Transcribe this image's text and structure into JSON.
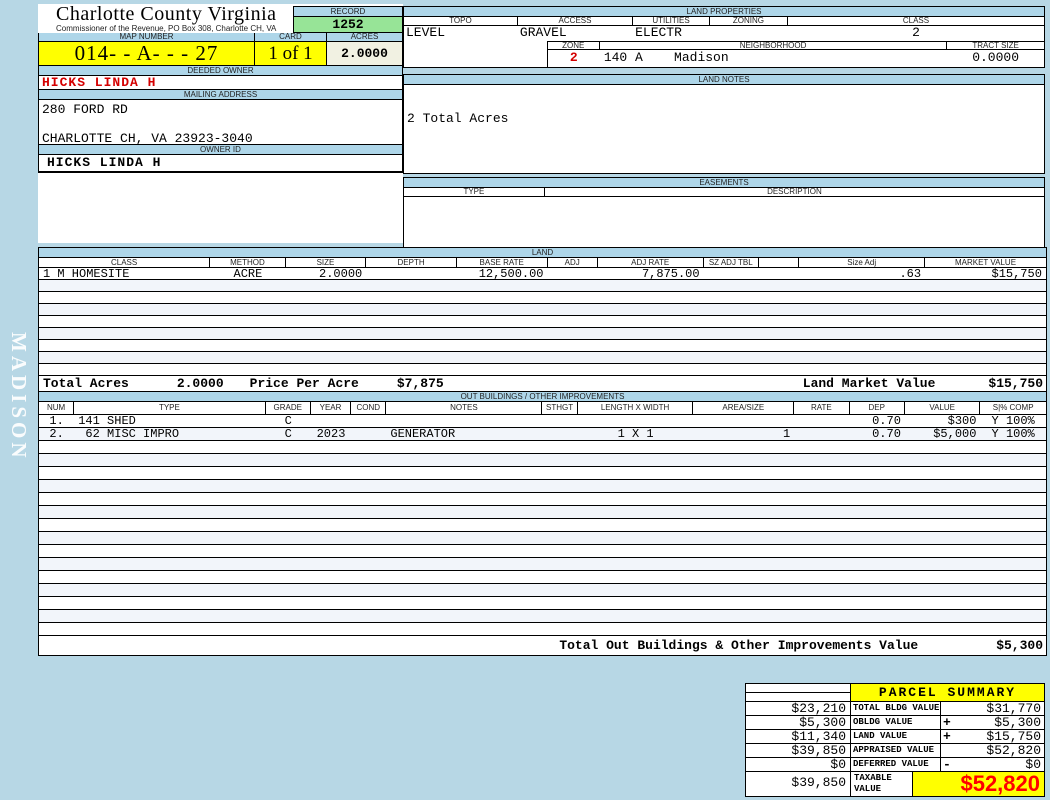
{
  "sidebar": {
    "label": "MADISON"
  },
  "header": {
    "title": "Charlotte County Virginia",
    "subtitle": "Commissioner of the Revenue, PO Box 308, Charlotte CH, VA",
    "record_label": "RECORD",
    "record_value": "1252",
    "map_label": "MAP NUMBER",
    "map_value": "014- - A-  -  - 27",
    "card_label": "CARD",
    "card_value": "1 of 1",
    "acres_label": "ACRES",
    "acres_value": "2.0000"
  },
  "owner": {
    "deeded_label": "DEEDED OWNER",
    "deeded_value": "HICKS LINDA H",
    "mailing_label": "MAILING ADDRESS",
    "address_line1": "280 FORD RD",
    "address_line2": "CHARLOTTE CH, VA 23923-3040",
    "owner_id_label": "OWNER ID",
    "owner_id_value": "HICKS LINDA H"
  },
  "land_properties": {
    "title": "LAND PROPERTIES",
    "topo_label": "TOPO",
    "topo": "LEVEL",
    "access_label": "ACCESS",
    "access": "GRAVEL",
    "utilities_label": "UTILITIES",
    "utilities": "ELECTR",
    "zoning_label": "ZONING",
    "zoning": "",
    "class_label": "CLASS",
    "class": "2",
    "zone_label": "ZONE",
    "zone": "2",
    "neighborhood_label": "NEIGHBORHOOD",
    "neighborhood_value": "140 A    Madison",
    "tract_label": "TRACT SIZE",
    "tract": "0.0000"
  },
  "land_notes": {
    "title": "LAND NOTES",
    "note": "2 Total Acres"
  },
  "easements": {
    "title": "EASEMENTS",
    "type_label": "TYPE",
    "description_label": "DESCRIPTION"
  },
  "land_table": {
    "title": "LAND",
    "columns": [
      {
        "label": "CLASS",
        "w": 17,
        "align": "left"
      },
      {
        "label": "METHOD",
        "w": 7.5,
        "align": "center"
      },
      {
        "label": "SIZE",
        "w": 8,
        "align": "right"
      },
      {
        "label": "DEPTH",
        "w": 9,
        "align": "right"
      },
      {
        "label": "BASE RATE",
        "w": 9,
        "align": "right"
      },
      {
        "label": "ADJ",
        "w": 5,
        "align": "right"
      },
      {
        "label": "ADJ RATE",
        "w": 10.5,
        "align": "right"
      },
      {
        "label": "SZ ADJ TBL",
        "w": 5.5,
        "align": "center"
      },
      {
        "label": "",
        "w": 4,
        "align": "center"
      },
      {
        "label": "Size Adj",
        "w": 12.5,
        "align": "right"
      },
      {
        "label": "MARKET VALUE",
        "w": 12,
        "align": "right"
      }
    ],
    "rows": [
      [
        "1 M HOMESITE",
        "ACRE",
        "2.0000",
        "",
        "12,500.00",
        "",
        "7,875.00",
        "",
        "",
        ".63",
        "$15,750"
      ]
    ],
    "empty_rows": 8,
    "totals": {
      "acres_label": "Total Acres",
      "acres": "2.0000",
      "ppa_label": "Price Per Acre",
      "ppa": "$7,875",
      "market_label": "Land Market Value",
      "market": "$15,750"
    }
  },
  "out_buildings": {
    "title": "OUT BUILDINGS / OTHER IMPROVEMENTS",
    "columns": [
      {
        "label": "NUM",
        "w": 3.5,
        "align": "center"
      },
      {
        "label": "TYPE",
        "w": 19,
        "align": "left"
      },
      {
        "label": "GRADE",
        "w": 4.5,
        "align": "center"
      },
      {
        "label": "YEAR",
        "w": 4,
        "align": "center"
      },
      {
        "label": "COND",
        "w": 3.5,
        "align": "center"
      },
      {
        "label": "NOTES",
        "w": 15.5,
        "align": "left"
      },
      {
        "label": "STHGT",
        "w": 3.5,
        "align": "center"
      },
      {
        "label": "LENGTH X WIDTH",
        "w": 11.5,
        "align": "center"
      },
      {
        "label": "AREA/SIZE",
        "w": 10,
        "align": "right"
      },
      {
        "label": "RATE",
        "w": 5.5,
        "align": "right"
      },
      {
        "label": "DEP",
        "w": 5.5,
        "align": "right"
      },
      {
        "label": "VALUE",
        "w": 7.5,
        "align": "right"
      },
      {
        "label": "S|% COMP",
        "w": 6.5,
        "align": "center"
      }
    ],
    "rows": [
      [
        "1.",
        "141 SHED",
        "C",
        "",
        "",
        "",
        "",
        "",
        "",
        "",
        "0.70",
        "$300",
        "Y 100%"
      ],
      [
        "2.",
        " 62 MISC IMPRO",
        "C",
        "2023",
        "",
        "GENERATOR",
        "",
        "1 X 1",
        "1",
        "",
        "0.70",
        "$5,000",
        "Y 100%"
      ]
    ],
    "empty_rows": 15,
    "total_label": "Total Out Buildings & Other Improvements Value",
    "total_value": "$5,300"
  },
  "parcel_summary": {
    "title": "PARCEL SUMMARY",
    "rows": [
      {
        "prior": "$23,210",
        "label": "TOTAL BLDG VALUE",
        "op": "",
        "value": "$31,770"
      },
      {
        "prior": "$5,300",
        "label": "OBLDG VALUE",
        "op": "+",
        "value": "$5,300"
      },
      {
        "prior": "$11,340",
        "label": "LAND VALUE",
        "op": "+",
        "value": "$15,750"
      },
      {
        "prior": "$39,850",
        "label": "APPRAISED VALUE",
        "op": "",
        "value": "$52,820"
      },
      {
        "prior": "$0",
        "label": "DEFERRED VALUE",
        "op": "-",
        "value": "$0"
      }
    ],
    "taxable": {
      "prior": "$39,850",
      "label": "TAXABLE VALUE",
      "value": "$52,820"
    }
  },
  "colors": {
    "page_bg": "#b7d7e5",
    "header_bar": "#aed6e9",
    "highlight_yellow": "#ffff00",
    "record_green": "#97e497",
    "acres_ivory": "#f1f1e2",
    "red_text": "#d40000"
  }
}
